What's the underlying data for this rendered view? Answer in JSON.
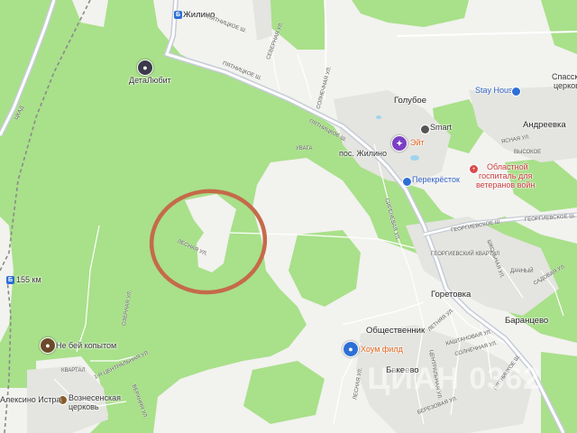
{
  "map": {
    "colors": {
      "forest": "#a9e08a",
      "open": "#f2f2ef",
      "built": "#e4e4e0",
      "road": "#ffffff",
      "highway": "#c7ccd6",
      "annotation": "#c56a4a"
    }
  },
  "places": {
    "zhilino_station": "Жилино",
    "detalyubit": "ДетаЛюбит",
    "goluboe": "Голубое",
    "smart": "Smart",
    "eit": "Эйт",
    "stay_house": "Stay House",
    "andreevka": "Андреевка",
    "pos_zhilino": "пос. Жилино",
    "perekrestok": "Перекрёсток",
    "hospital_line1": "Областной",
    "hospital_line2": "госпиталь для",
    "hospital_line3": "ветеранов войн",
    "vysokoe": "ВЫСОКОЕ",
    "spasskaya_1": "Спасск",
    "spasskaya_2": "церков",
    "station_155": "155 км",
    "ne_bei": "Не бей копытом",
    "goretovka": "Горетовка",
    "baranceevo": "Баранцево",
    "obshestvennik": "Общественник",
    "houm_fild": "Хоум филд",
    "bakeevo": "Бакеево",
    "voznesenskaya_1": "Вознесенская",
    "voznesenskaya_2": "церковь",
    "alexino": "Алексино Истра",
    "kvartal": "КВАРТАЛ",
    "dachny": "ДАЧНЫЙ",
    "georgievsky_kvartal": "ГЕОРГИЕВСКИЙ КВАРТАЛ",
    "uvaga": "УВАГА"
  },
  "streets": {
    "pyatnitskoe_1": "ПЯТНИЦКОЕ Ш.",
    "pyatnitskoe_2": "ПЯТНИЦКОЕ Ш.",
    "pyatnitskoe_3": "ПЯТНИЦКОЕ Ш.",
    "pyatnitskoe_4": "ПЯТНИЦКОЕ Ш.",
    "georgievskoe_1": "ГЕОРГИЕВСКОЕ Ш.",
    "georgievskoe_2": "ГЕОРГИЕВСКОЕ Ш.",
    "lesnaya": "ЛЕСНАЯ УЛ.",
    "sirenevaya": "СИРЕНЕВАЯ УЛ.",
    "tsentralnaya": "1-Я ЦЕНТРАЛЬНАЯ УЛ.",
    "yasnaya": "ЯСНАЯ УЛ.",
    "lesnaya2": "ЛЕСНАЯ УЛ.",
    "kashtanovaya": "КАШТАНОВАЯ УЛ.",
    "solnechnaya": "СОЛНЕЧНАЯ УЛ.",
    "berezovaya": "БЕРЕЗОВАЯ УЛ.",
    "letnyaya": "ЛЕТНЯЯ УЛ.",
    "shkolnaya": "ШКОЛЬНАЯ УЛ.",
    "tsentralnaya2": "ЦЕНТРАЛЬНАЯ УЛ.",
    "sadovaya": "САДОВАЯ УЛ.",
    "severnaya": "СЕВЕРНАЯ УЛ.",
    "solnechnaya2": "СОЛНЕЧНАЯ УЛ.",
    "tsad": "ЦКАД",
    "verhnyaya": "ВЕРХНЯЯ УЛ.",
    "ozernaya": "ОЗЕРНАЯ УЛ."
  },
  "watermark": "ЦИАН 0362"
}
